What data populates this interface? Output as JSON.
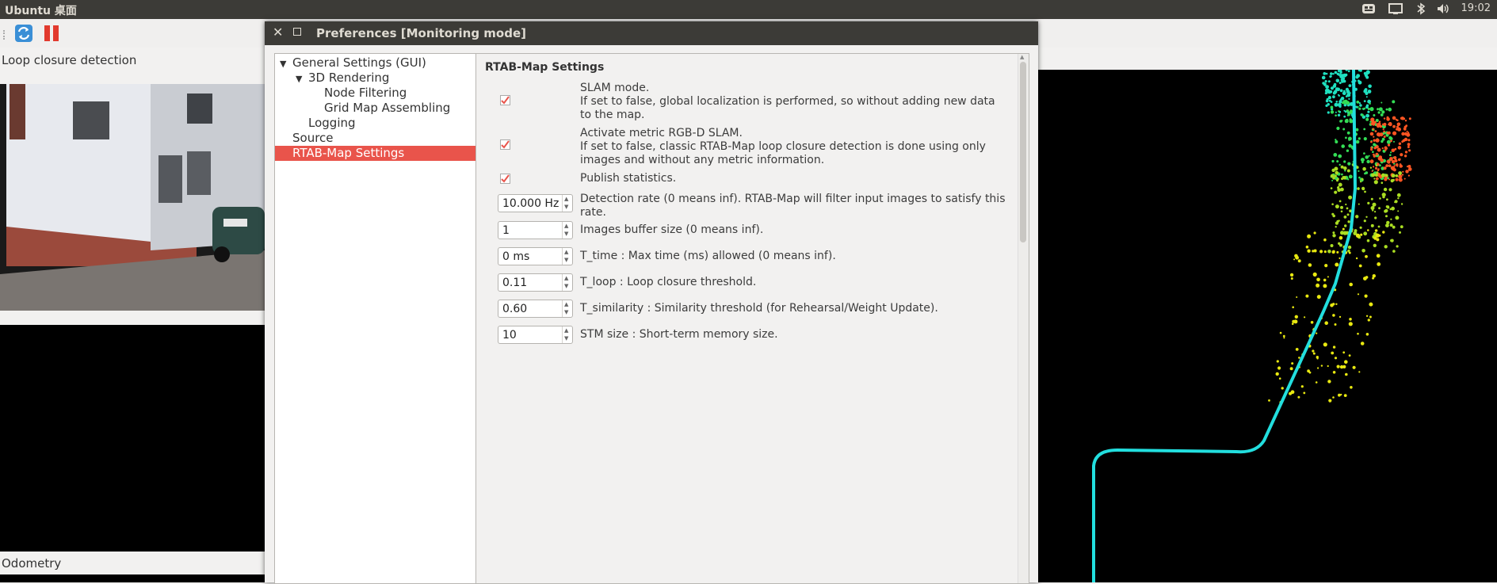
{
  "topbar": {
    "title": "Ubuntu 桌面",
    "clock": "19:02",
    "indicators": [
      "keyboard-icon",
      "network-icon",
      "bluetooth-icon",
      "volume-icon"
    ]
  },
  "toolbar": {
    "buttons": [
      "refresh-icon",
      "pause-icon"
    ]
  },
  "panels": {
    "loop_closure_label": "Loop closure detection",
    "odometry_label": "Odometry"
  },
  "dialog": {
    "title": "Preferences [Monitoring mode]",
    "tree": [
      {
        "label": "General Settings (GUI)",
        "level": 0,
        "expanded": true
      },
      {
        "label": "3D Rendering",
        "level": 1,
        "expanded": true
      },
      {
        "label": "Node Filtering",
        "level": 2
      },
      {
        "label": "Grid Map Assembling",
        "level": 2
      },
      {
        "label": "Logging",
        "level": 1
      },
      {
        "label": "Source",
        "level": 0
      },
      {
        "label": "RTAB-Map Settings",
        "level": 0,
        "selected": true
      }
    ],
    "content_title": "RTAB-Map Settings",
    "settings": {
      "slam_mode": {
        "checked": true,
        "text_line1": "SLAM mode.",
        "text_rest": " If set to false, global localization is performed, so without adding new data to the map."
      },
      "metric_slam": {
        "checked": true,
        "text_line1": "Activate metric RGB-D SLAM.",
        "text_rest": "If set to false, classic RTAB-Map loop closure detection is done using only images and without any metric information."
      },
      "publish_stats": {
        "checked": true,
        "text": "Publish statistics."
      },
      "detection_rate": {
        "value": "10.000 Hz",
        "text": "Detection rate (0 means inf). RTAB-Map will filter input images to satisfy this rate."
      },
      "buffer_size": {
        "value": "1",
        "text": "Images buffer size (0 means inf)."
      },
      "t_time": {
        "value": "0 ms",
        "text": "T_time : Max time (ms) allowed (0 means inf)."
      },
      "t_loop": {
        "value": "0.11",
        "text": "T_loop : Loop closure threshold."
      },
      "t_similarity": {
        "value": "0.60",
        "text": "T_similarity : Similarity threshold (for Rehearsal/Weight Update)."
      },
      "stm_size": {
        "value": "10",
        "text": "STM size : Short-term memory size."
      }
    }
  },
  "colors": {
    "panel": "#3c3b37",
    "selection": "#e9544b",
    "check": "#e9544b",
    "trajectory": "#22dede"
  }
}
